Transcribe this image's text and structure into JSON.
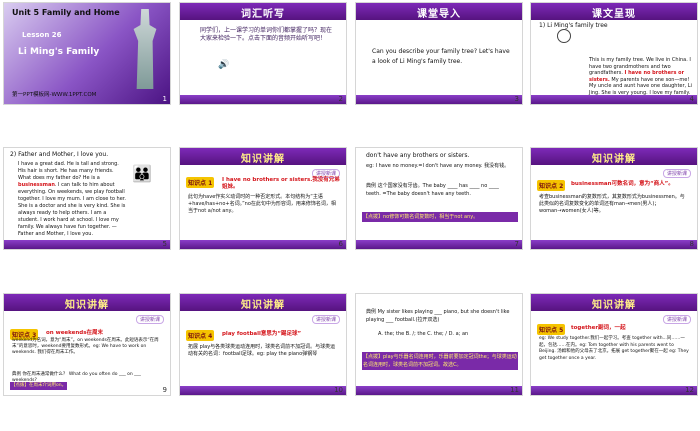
{
  "slides": [
    {
      "n": "1",
      "title": "Unit 5  Family and Home",
      "lesson": "Lesson 26",
      "name": "Li Ming's Family",
      "site": "第一PPT模板网-WWW.1PPT.COM"
    },
    {
      "n": "2",
      "title": "词汇听写",
      "text": "同学们，上一课学习的单词你们都掌握了吗？现在大家来检验一下。点击下面的音频开始听写吧！"
    },
    {
      "n": "3",
      "title": "课堂导入",
      "text": "Can you describe your family tree? Let's have a look of Li Ming's family tree."
    },
    {
      "n": "4",
      "title": "课文呈现",
      "item": "1) Li Ming's family tree",
      "text": "This is my family tree. We live in China. I have two grandmothers and two grandfathers.",
      "red": "I have no brothers or sisters.",
      "text2": "My parents have one son—me! My uncle and aunt have one daughter, Li Jing. She is very young. I love my family."
    },
    {
      "n": "5",
      "item": "2) Father and Mother, I love you.",
      "text": "I have a great dad. He is tall and strong. His hair is short. He has many friends. What does my father do? He is a",
      "red": "businessman",
      "text2": ". I can talk to him about everything. On weekends, we play football together. I love my mum. I am close to her. She is a doctor and she is very kind. She is always ready to help others. I am a student. I work hard at school. I love my family. We always have fun together. —Father and Mother, I love you."
    },
    {
      "n": "6",
      "title": "知识讲解",
      "tag": "知识点 1",
      "head": "I have no brothers or sisters.我没有兄弟姐妹。",
      "text": "此句为have作实义动词时的一种否定形式。本句结构为“主语+have/has+no+名词。”no在此句中为形容词，用来修饰名词，相当于not a/not any。"
    },
    {
      "n": "7",
      "text": "don't have any brothers or sisters.",
      "eg": "eg: I have no money.=I don't have any money. 我没有钱。",
      "ex": "典例  这个国家没有牙齿。The baby ____ has ____ no ____ teeth. =The baby doesn't have any teeth.",
      "red": "【点拨】no修饰可数名词复数时，相当于not any。"
    },
    {
      "n": "8",
      "title": "知识讲解",
      "tag": "知识点 2",
      "head": "businessman可数名词，意为“商人”。",
      "text": "考查businessman的复数形式，其复数形式为businessmen。与此类似的名词复数变化的单词还有man→men(男人)；woman→women(女人)等。"
    },
    {
      "n": "9",
      "title": "知识讲解",
      "tag": "知识点 3",
      "head": "on weekends在周末",
      "text": "weekend为名词，意为“周末”。on weekends在周末。此短语表示“在周末”的意思时，weekend要用复数形式。eg: We have to work on weekends. 我们得在周末工作。",
      "ex": "典例  你在周末通常做什么？ What do you often do ___ on ___ weekends?",
      "red": "【点拨】在周末介词用on。"
    },
    {
      "n": "10",
      "title": "知识讲解",
      "tag": "知识点 4",
      "head": "play football意思为“踢足球”",
      "text": "拓展  play与各类球类运动连用时，球类名词前不加冠词。与球类运动有关的名词：football足球。eg: play the piano弹钢琴"
    },
    {
      "n": "11",
      "text": "典例  My sister likes playing ___ piano, but she doesn't like playing ___ football.(拉开双选)",
      "opts": "A. the; the   B. /; the   C. the; /   D. a; an",
      "red": "【点拨】play与乐器名词连用时，乐器前要加定冠词the；与球类运动名词连用时，球类名词前不加冠词。故选C。"
    },
    {
      "n": "12",
      "title": "知识讲解",
      "tag": "知识点 5",
      "head": "together副词，一起",
      "text": "eg: We study together.我们一起学习。考查 together with...同……一起，包括……在内。eg: Tom together with his parents went to Beijing. 汤姆和他的父母去了北京。拓展 get together聚在一起 eg: They get together once a year."
    }
  ],
  "corner_tag": "讲授新课"
}
